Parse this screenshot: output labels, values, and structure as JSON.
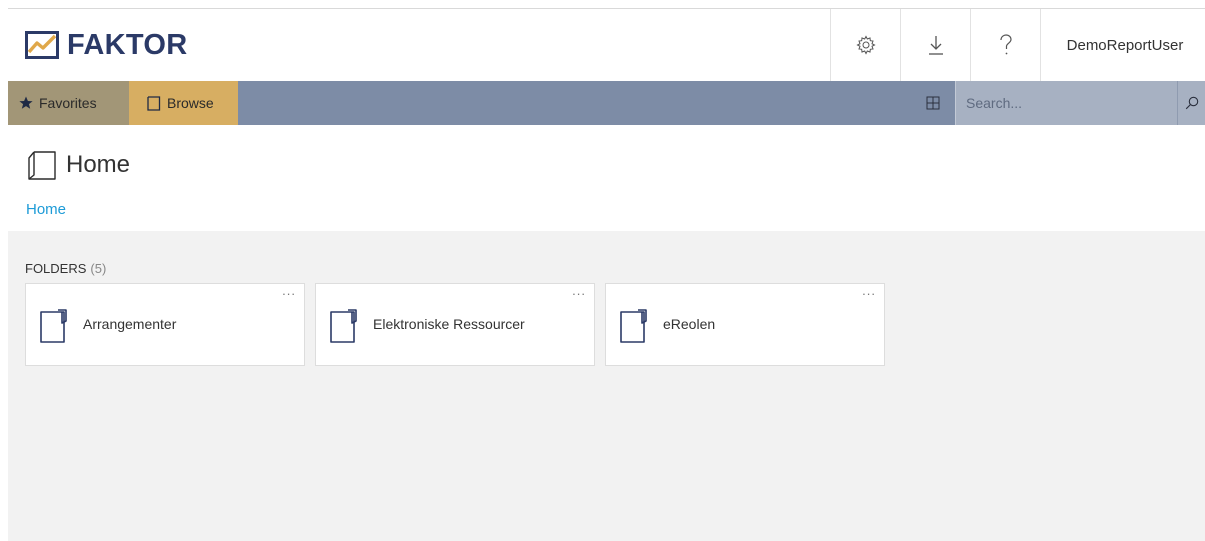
{
  "header": {
    "brand": "FAKTOR",
    "user": "DemoReportUser",
    "icons": [
      "settings-gear-icon",
      "download-icon",
      "help-icon"
    ],
    "brand_color": "#2b3a67"
  },
  "nav": {
    "favorites_label": "Favorites",
    "browse_label": "Browse",
    "search_placeholder": "Search...",
    "bar_color": "#7d8ca6",
    "favorites_color": "#a29677",
    "browse_color": "#d7ae62"
  },
  "page": {
    "title": "Home",
    "breadcrumb": "Home"
  },
  "folders": {
    "label": "FOLDERS",
    "count": "(5)",
    "menu_label": "...",
    "items": [
      {
        "label": "Arrangementer"
      },
      {
        "label": "Elektroniske Ressourcer"
      },
      {
        "label": "eReolen"
      }
    ]
  }
}
